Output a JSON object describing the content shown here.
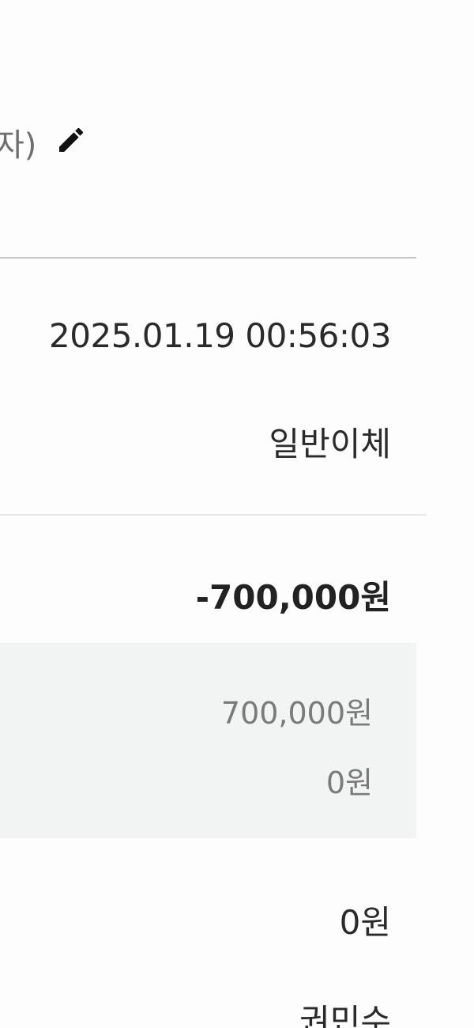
{
  "header": {
    "name_fragment": "자)",
    "edit_icon": "pencil-icon"
  },
  "info": {
    "datetime": "2025.01.19 00:56:03",
    "transfer_type": "일반이체"
  },
  "amount": {
    "total": "-700,000원",
    "details": [
      "700,000원",
      "0원"
    ]
  },
  "fee": "0원",
  "bottom_partial": "권민수",
  "colors": {
    "divider": "#c8c8c8",
    "detail_bg": "#f2f3f3",
    "muted_text": "#7a7a7a"
  }
}
